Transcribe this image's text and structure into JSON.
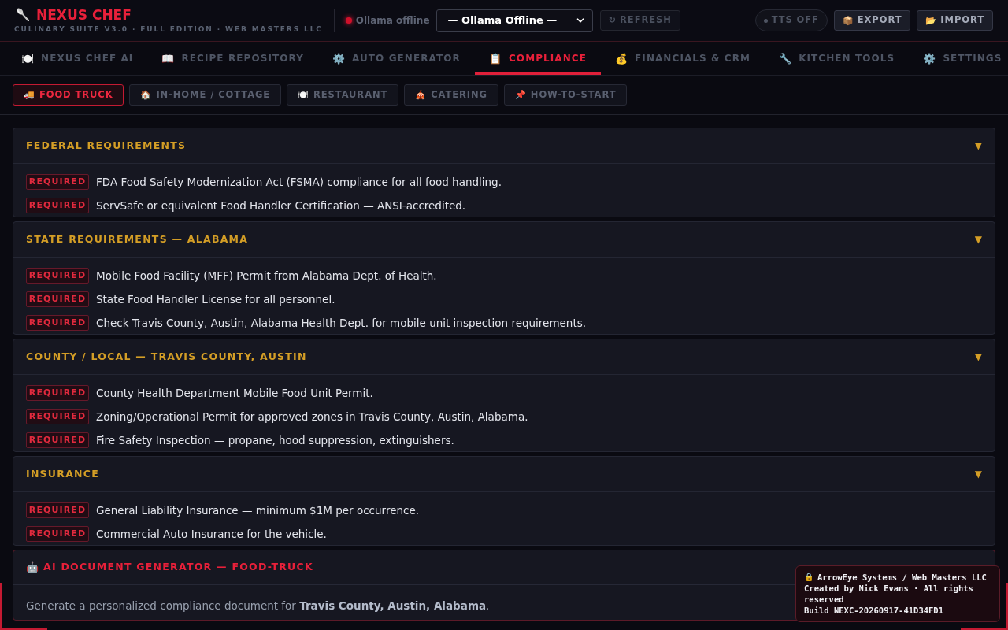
{
  "app": {
    "logo_icon": "🥄",
    "title": "NEXUS CHEF",
    "subtitle": "CULINARY SUITE V3.0 · FULL EDITION · WEB MASTERS LLC"
  },
  "status": {
    "label": "Ollama offline",
    "online": false
  },
  "model_select": {
    "value": "— Ollama Offline —"
  },
  "refresh_button": {
    "icon": "↻",
    "label": "REFRESH",
    "disabled": true
  },
  "tts_toggle": {
    "label": "TTS OFF",
    "on": false
  },
  "header_buttons": [
    {
      "icon": "📦",
      "label": "EXPORT"
    },
    {
      "icon": "📂",
      "label": "IMPORT"
    }
  ],
  "tabs": [
    {
      "icon": "🍽️",
      "label": "NEXUS CHEF AI",
      "selected": false
    },
    {
      "icon": "📖",
      "label": "RECIPE REPOSITORY",
      "selected": false
    },
    {
      "icon": "⚙️",
      "label": "AUTO GENERATOR",
      "selected": false
    },
    {
      "icon": "📋",
      "label": "COMPLIANCE",
      "selected": true
    },
    {
      "icon": "💰",
      "label": "FINANCIALS & CRM",
      "selected": false
    },
    {
      "icon": "🔧",
      "label": "KITCHEN TOOLS",
      "selected": false
    },
    {
      "icon": "⚙️",
      "label": "SETTINGS",
      "selected": false
    }
  ],
  "subtabs": [
    {
      "icon": "🚚",
      "label": "FOOD TRUCK",
      "selected": true
    },
    {
      "icon": "🏠",
      "label": "IN-HOME / COTTAGE",
      "selected": false
    },
    {
      "icon": "🍽️",
      "label": "RESTAURANT",
      "selected": false
    },
    {
      "icon": "🎪",
      "label": "CATERING",
      "selected": false
    },
    {
      "icon": "📌",
      "label": "HOW-TO-START",
      "selected": false
    }
  ],
  "sections": [
    {
      "title": "FEDERAL REQUIREMENTS",
      "toggle": "▼",
      "items": [
        {
          "badge": "REQUIRED",
          "text": "FDA Food Safety Modernization Act (FSMA) compliance for all food handling."
        },
        {
          "badge": "REQUIRED",
          "text": "ServSafe or equivalent Food Handler Certification — ANSI-accredited."
        }
      ]
    },
    {
      "title": "STATE REQUIREMENTS — ALABAMA",
      "toggle": "▼",
      "items": [
        {
          "badge": "REQUIRED",
          "text": "Mobile Food Facility (MFF) Permit from Alabama Dept. of Health."
        },
        {
          "badge": "REQUIRED",
          "text": "State Food Handler License for all personnel."
        },
        {
          "badge": "REQUIRED",
          "text": "Check Travis County, Austin, Alabama Health Dept. for mobile unit inspection requirements."
        }
      ]
    },
    {
      "title": "COUNTY / LOCAL — TRAVIS COUNTY, AUSTIN",
      "toggle": "▼",
      "items": [
        {
          "badge": "REQUIRED",
          "text": "County Health Department Mobile Food Unit Permit."
        },
        {
          "badge": "REQUIRED",
          "text": "Zoning/Operational Permit for approved zones in Travis County, Austin, Alabama."
        },
        {
          "badge": "REQUIRED",
          "text": "Fire Safety Inspection — propane, hood suppression, extinguishers."
        }
      ]
    },
    {
      "title": "INSURANCE",
      "toggle": "▼",
      "items": [
        {
          "badge": "REQUIRED",
          "text": "General Liability Insurance — minimum $1M per occurrence."
        },
        {
          "badge": "REQUIRED",
          "text": "Commercial Auto Insurance for the vehicle."
        }
      ]
    }
  ],
  "ai_generator": {
    "icon": "🤖",
    "title": "AI DOCUMENT GENERATOR — FOOD-TRUCK",
    "description": "Generate a personalized compliance document for **Travis County, Austin, Alabama**."
  },
  "footer_badge": {
    "icon": "🔒",
    "lines": [
      "ArrowEye Systems / Web Masters LLC",
      "Created by Nick Evans · All rights reserved",
      "Build NEXC-20260917-41D34FD1"
    ]
  }
}
